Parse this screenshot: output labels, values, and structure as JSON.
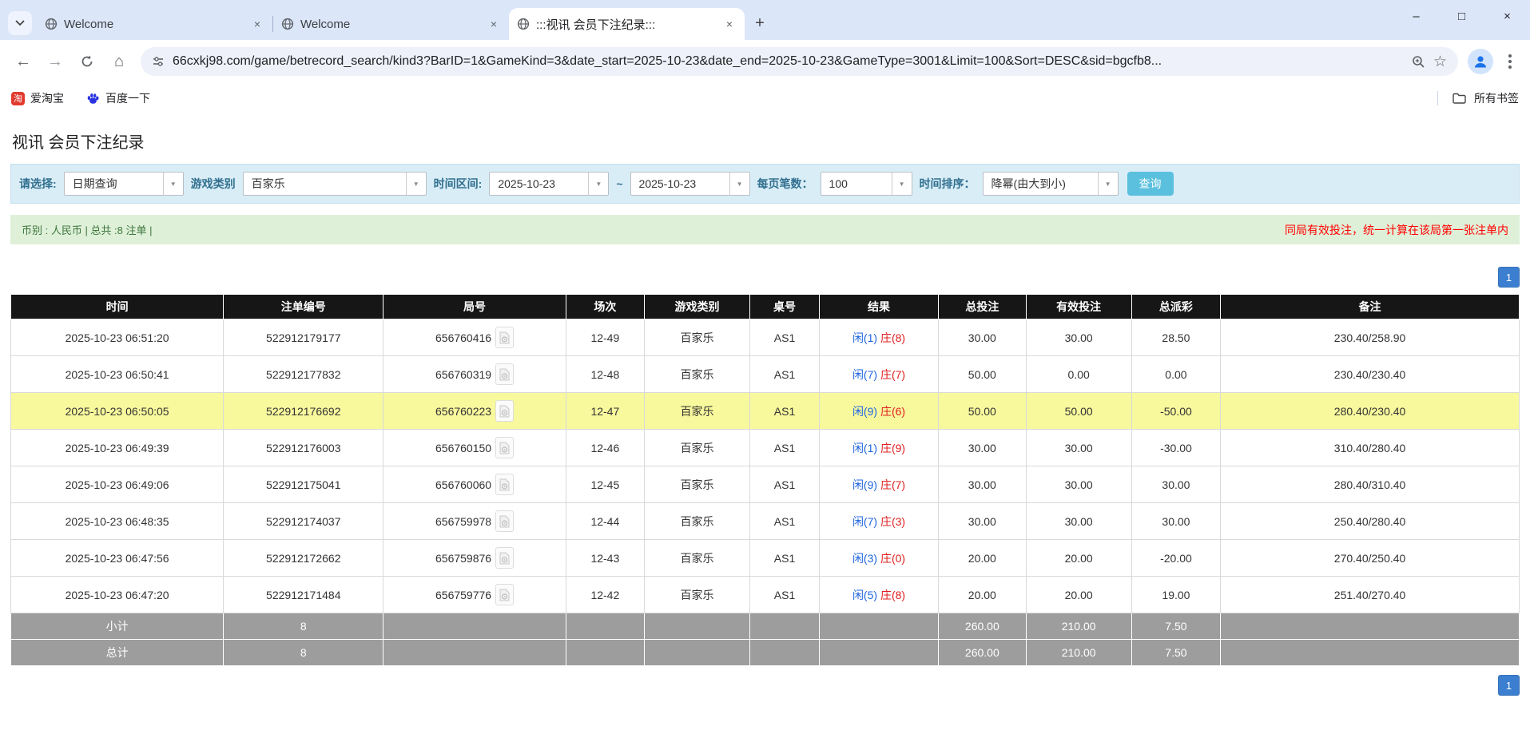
{
  "browser": {
    "tabs": [
      {
        "title": "Welcome"
      },
      {
        "title": "Welcome"
      },
      {
        "title": ":::视讯 会员下注纪录:::"
      }
    ],
    "url": "66cxkj98.com/game/betrecord_search/kind3?BarID=1&GameKind=3&date_start=2025-10-23&date_end=2025-10-23&GameType=3001&Limit=100&Sort=DESC&sid=bgcfb8...",
    "bookmarks": {
      "taobao_icon_text": "淘",
      "taobao": "爱淘宝",
      "baidu": "百度一下",
      "all_bookmarks": "所有书签"
    }
  },
  "page": {
    "title": "视讯 会员下注纪录",
    "filters": {
      "select_label": "请选择:",
      "select_value": "日期查询",
      "game_type_label": "游戏类别",
      "game_type_value": "百家乐",
      "date_range_label": "时间区间:",
      "date_start": "2025-10-23",
      "tilde": "~",
      "date_end": "2025-10-23",
      "page_size_label": "每页笔数：",
      "page_size_value": "100",
      "sort_label": "时间排序：",
      "sort_value": "降幂(由大到小)",
      "search_button": "查询"
    },
    "summary_left": "币别 : 人民币 | 总共 :8 注单 |",
    "summary_right": "同局有效投注，统一计算在该局第一张注单内",
    "pagination": "1",
    "table": {
      "headers": [
        "时间",
        "注单编号",
        "局号",
        "场次",
        "游戏类别",
        "桌号",
        "结果",
        "总投注",
        "有效投注",
        "总派彩",
        "备注"
      ],
      "rows": [
        {
          "time": "2025-10-23 06:51:20",
          "bet_id": "522912179177",
          "round_id": "656760416",
          "session": "12-49",
          "game": "百家乐",
          "table": "AS1",
          "player": "闲(1)",
          "banker": "庄(8)",
          "total_bet": "30.00",
          "valid_bet": "30.00",
          "payout": "28.50",
          "note": "230.40/258.90",
          "highlight": false
        },
        {
          "time": "2025-10-23 06:50:41",
          "bet_id": "522912177832",
          "round_id": "656760319",
          "session": "12-48",
          "game": "百家乐",
          "table": "AS1",
          "player": "闲(7)",
          "banker": "庄(7)",
          "total_bet": "50.00",
          "valid_bet": "0.00",
          "payout": "0.00",
          "note": "230.40/230.40",
          "highlight": false
        },
        {
          "time": "2025-10-23 06:50:05",
          "bet_id": "522912176692",
          "round_id": "656760223",
          "session": "12-47",
          "game": "百家乐",
          "table": "AS1",
          "player": "闲(9)",
          "banker": "庄(6)",
          "total_bet": "50.00",
          "valid_bet": "50.00",
          "payout": "-50.00",
          "note": "280.40/230.40",
          "highlight": true
        },
        {
          "time": "2025-10-23 06:49:39",
          "bet_id": "522912176003",
          "round_id": "656760150",
          "session": "12-46",
          "game": "百家乐",
          "table": "AS1",
          "player": "闲(1)",
          "banker": "庄(9)",
          "total_bet": "30.00",
          "valid_bet": "30.00",
          "payout": "-30.00",
          "note": "310.40/280.40",
          "highlight": false
        },
        {
          "time": "2025-10-23 06:49:06",
          "bet_id": "522912175041",
          "round_id": "656760060",
          "session": "12-45",
          "game": "百家乐",
          "table": "AS1",
          "player": "闲(9)",
          "banker": "庄(7)",
          "total_bet": "30.00",
          "valid_bet": "30.00",
          "payout": "30.00",
          "note": "280.40/310.40",
          "highlight": false
        },
        {
          "time": "2025-10-23 06:48:35",
          "bet_id": "522912174037",
          "round_id": "656759978",
          "session": "12-44",
          "game": "百家乐",
          "table": "AS1",
          "player": "闲(7)",
          "banker": "庄(3)",
          "total_bet": "30.00",
          "valid_bet": "30.00",
          "payout": "30.00",
          "note": "250.40/280.40",
          "highlight": false
        },
        {
          "time": "2025-10-23 06:47:56",
          "bet_id": "522912172662",
          "round_id": "656759876",
          "session": "12-43",
          "game": "百家乐",
          "table": "AS1",
          "player": "闲(3)",
          "banker": "庄(0)",
          "total_bet": "20.00",
          "valid_bet": "20.00",
          "payout": "-20.00",
          "note": "270.40/250.40",
          "highlight": false
        },
        {
          "time": "2025-10-23 06:47:20",
          "bet_id": "522912171484",
          "round_id": "656759776",
          "session": "12-42",
          "game": "百家乐",
          "table": "AS1",
          "player": "闲(5)",
          "banker": "庄(8)",
          "total_bet": "20.00",
          "valid_bet": "20.00",
          "payout": "19.00",
          "note": "251.40/270.40",
          "highlight": false
        }
      ],
      "subtotal": {
        "label": "小计",
        "count": "8",
        "total_bet": "260.00",
        "valid_bet": "210.00",
        "payout": "7.50"
      },
      "total": {
        "label": "总计",
        "count": "8",
        "total_bet": "260.00",
        "valid_bet": "210.00",
        "payout": "7.50"
      }
    },
    "colors": {
      "table_header_bg": "#161616",
      "highlight_row": "#f8f89d",
      "summary_row_bg": "#9d9d9d",
      "filter_bar_bg": "#d9edf7",
      "info_bar_bg": "#dff0d8",
      "search_button_bg": "#5bc0de",
      "pagination_bg": "#3c7fd0",
      "amount_blue": "#2166e0",
      "negative_red": "#ff0000",
      "player_blue": "#2166e0",
      "banker_red": "#e02020"
    }
  }
}
